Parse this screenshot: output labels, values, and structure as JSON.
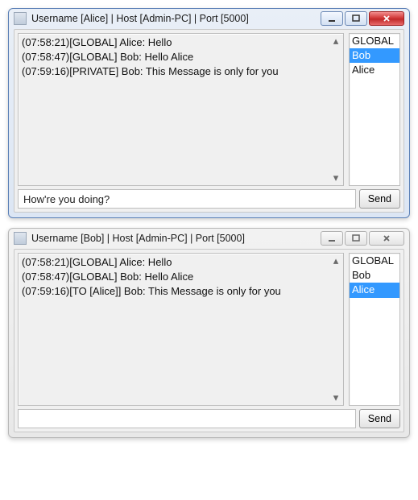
{
  "windows": [
    {
      "active": true,
      "title": "Username [Alice] | Host [Admin-PC] | Port [5000]",
      "messages": [
        "(07:58:21)[GLOBAL] Alice: Hello",
        "(07:58:47)[GLOBAL] Bob: Hello Alice",
        "(07:59:16)[PRIVATE] Bob: This Message is only for you"
      ],
      "users": [
        {
          "name": "GLOBAL",
          "selected": false
        },
        {
          "name": "Bob",
          "selected": true
        },
        {
          "name": "Alice",
          "selected": false
        }
      ],
      "input_value": "How're you doing?",
      "send_label": "Send"
    },
    {
      "active": false,
      "title": "Username [Bob] | Host [Admin-PC] | Port [5000]",
      "messages": [
        "(07:58:21)[GLOBAL] Alice: Hello",
        "(07:58:47)[GLOBAL] Bob: Hello Alice",
        "(07:59:16)[TO [Alice]] Bob: This Message is only for you"
      ],
      "users": [
        {
          "name": "GLOBAL",
          "selected": false
        },
        {
          "name": "Bob",
          "selected": false
        },
        {
          "name": "Alice",
          "selected": true
        }
      ],
      "input_value": "",
      "send_label": "Send"
    }
  ]
}
